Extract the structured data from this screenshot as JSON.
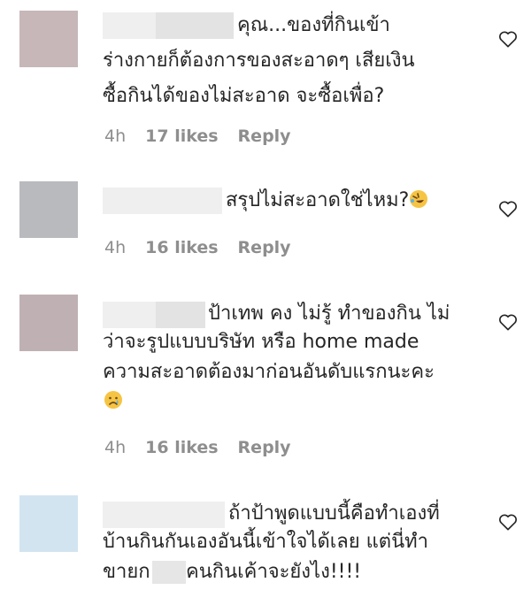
{
  "comments": [
    {
      "lines": [
        "คุณ...ของที่กินเข้า",
        "ร่างกายก็ต้องการของสะอาดๆ เสียเงิน",
        "ซื้อกินได้ของไม่สะอาด จะซื้อเพื่อ?"
      ],
      "time": "4h",
      "likes": "17 likes",
      "reply": "Reply",
      "avatar_color": "#c7b7b8",
      "icon": "heart-outline-icon"
    },
    {
      "lines": [
        "สรุปไม่สะอาดใช่ไหม?"
      ],
      "emoji": "rolling-on-floor-laughing-emoji",
      "time": "4h",
      "likes": "16 likes",
      "reply": "Reply",
      "avatar_color": "#b8babe",
      "icon": "heart-outline-icon"
    },
    {
      "lines": [
        "ป้าเทพ คง ไม่รู้ ทำของกิน ไม่",
        "ว่าจะรูปแบบบริษัท หรือ home made",
        "ความสะอาดต้องมาก่อนอันดับแรกนะคะ"
      ],
      "emoji": "crying-face-emoji",
      "time": "4h",
      "likes": "16 likes",
      "reply": "Reply",
      "avatar_color": "#bfb1b3",
      "icon": "heart-outline-icon"
    },
    {
      "lines": [
        "ถ้าป้าพูดแบบนี้คือทำเองที่",
        "บ้านกินกันเองอันนี้เข้าใจได้เลย แต่นี่ทำ",
        "ขายก",
        "คนกินเค้าจะยังไง!!!!"
      ],
      "avatar_color": "#d3e4f1",
      "icon": "heart-outline-icon"
    }
  ]
}
